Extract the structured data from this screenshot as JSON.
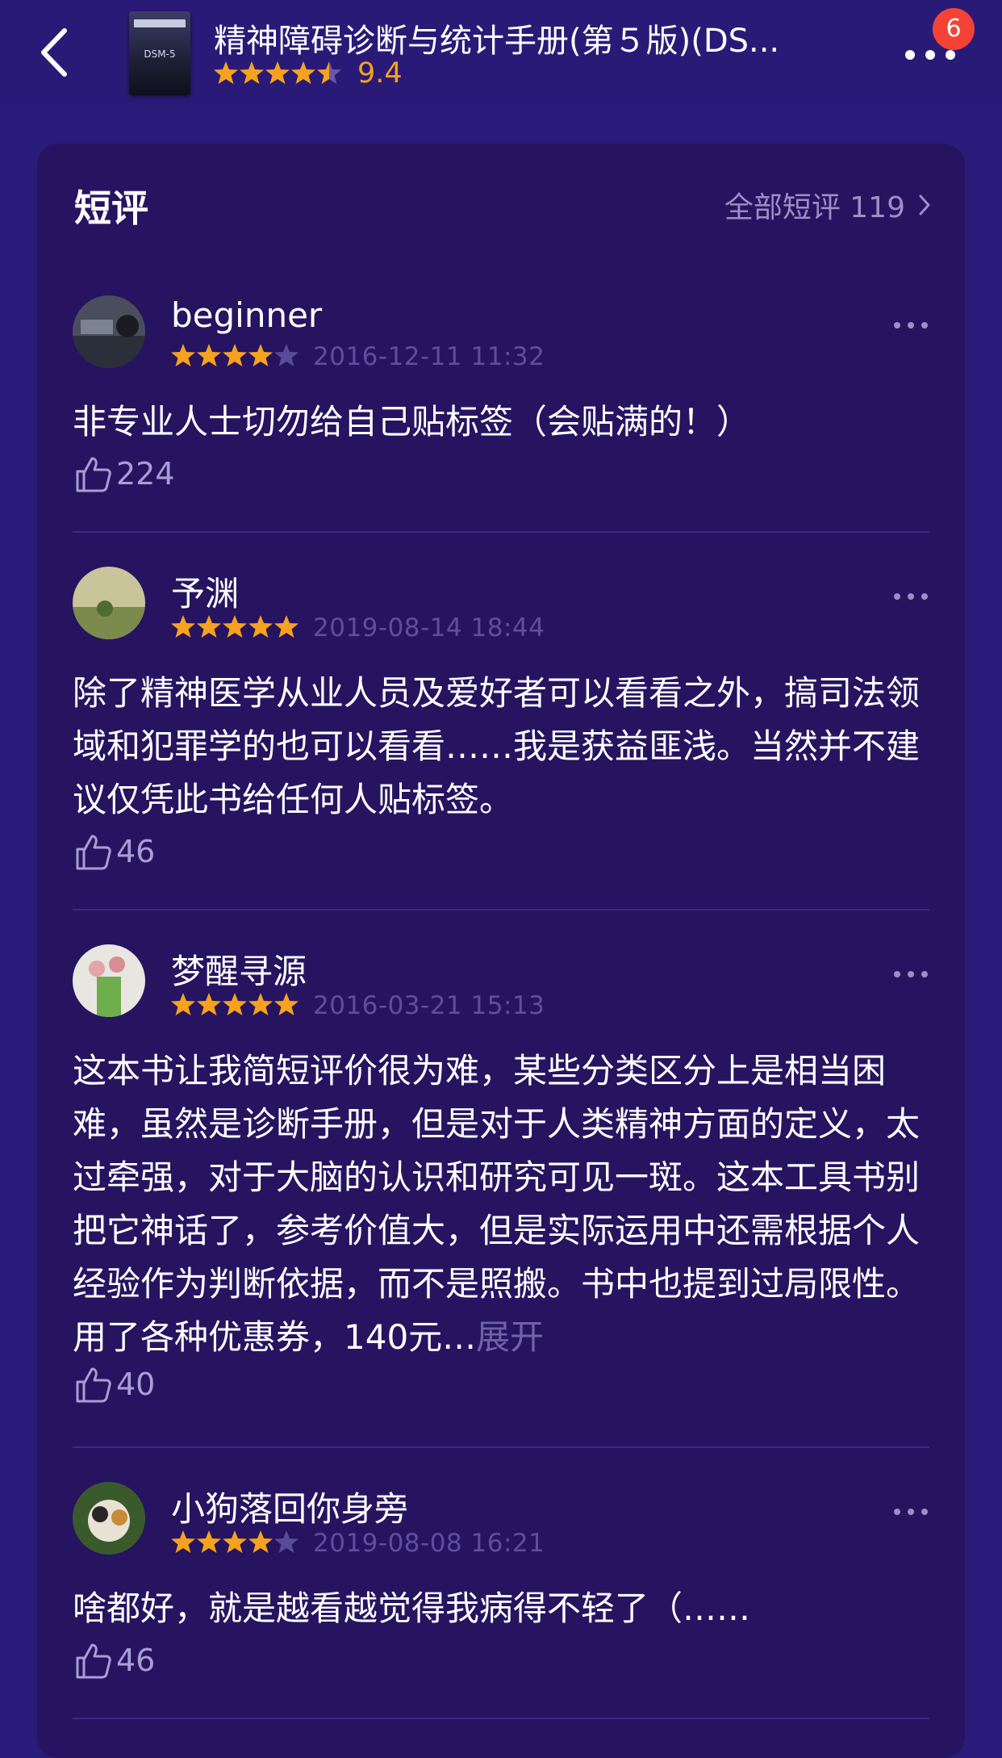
{
  "header": {
    "book_title": "精神障碍诊断与统计手册(第５版)(DS...",
    "cover_label": "DSM-5",
    "score": "9.4",
    "stars": 4.5,
    "notification_count": "6"
  },
  "section": {
    "title": "短评",
    "all_label": "全部短评 119"
  },
  "colors": {
    "background": "#2a1a7a",
    "card": "#261461",
    "star": "#f6a21e",
    "badge": "#f44336"
  },
  "reviews": [
    {
      "user": "beginner",
      "stars": 4,
      "date": "2016-12-11 11:32",
      "text": "非专业人士切勿给自己贴标签（会贴满的！）",
      "likes": "224"
    },
    {
      "user": "予渊",
      "stars": 5,
      "date": "2019-08-14 18:44",
      "text": "除了精神医学从业人员及爱好者可以看看之外，搞司法领域和犯罪学的也可以看看……我是获益匪浅。当然并不建议仅凭此书给任何人贴标签。",
      "likes": "46"
    },
    {
      "user": "梦醒寻源",
      "stars": 5,
      "date": "2016-03-21 15:13",
      "text": "这本书让我简短评价很为难，某些分类区分上是相当困难，虽然是诊断手册，但是对于人类精神方面的定义，太过牵强，对于大脑的认识和研究可见一斑。这本工具书别把它神话了，参考价值大，但是实际运用中还需根据个人经验作为判断依据，而不是照搬。书中也提到过局限性。用了各种优惠券，140元…",
      "expand_label": "展开",
      "likes": "40"
    },
    {
      "user": "小狗落回你身旁",
      "stars": 4,
      "date": "2019-08-08 16:21",
      "text": "啥都好，就是越看越觉得我病得不轻了（……",
      "likes": "46"
    }
  ]
}
